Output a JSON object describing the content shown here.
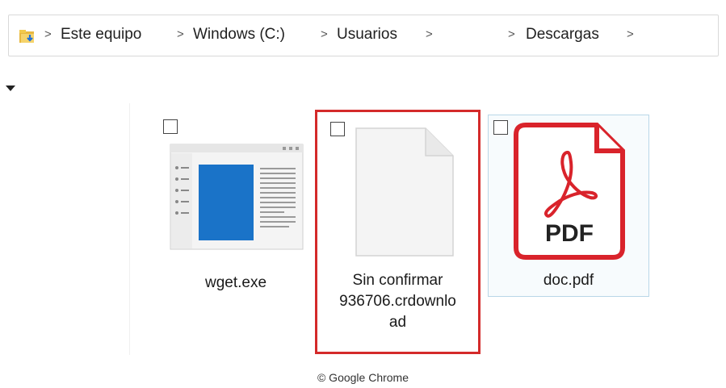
{
  "breadcrumb": {
    "items": [
      {
        "label": "Este equipo"
      },
      {
        "label": "Windows (C:)"
      },
      {
        "label": "Usuarios"
      },
      {
        "label": ""
      },
      {
        "label": "Descargas"
      }
    ],
    "separator": ">"
  },
  "files": [
    {
      "name_lines": [
        "wget.exe"
      ],
      "icon": "application-window-icon",
      "state": "normal",
      "checked": false
    },
    {
      "name_lines": [
        "Sin confirmar",
        "936706.crdownlo",
        "ad"
      ],
      "icon": "blank-document-icon",
      "state": "highlighted",
      "checked": false
    },
    {
      "name_lines": [
        "doc.pdf"
      ],
      "icon": "pdf-file-icon",
      "state": "hover",
      "checked": false
    }
  ],
  "pdf_icon_text": "PDF",
  "credit": "© Google Chrome",
  "colors": {
    "highlight": "#d42a2a",
    "hover_border": "#b9d7e8",
    "window_blue": "#1a73c8"
  }
}
